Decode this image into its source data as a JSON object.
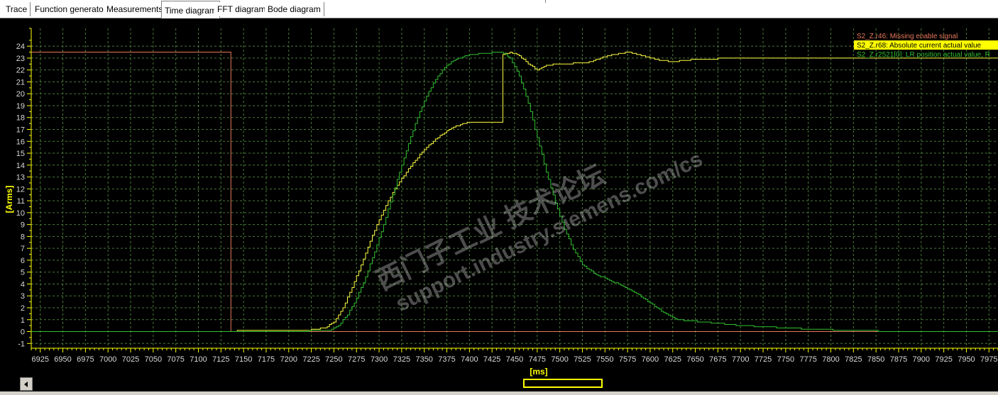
{
  "tabs": [
    {
      "label": "Trace"
    },
    {
      "label": "Function generator"
    },
    {
      "label": "Measurements"
    },
    {
      "label": "Time diagram",
      "active": true
    },
    {
      "label": "FFT diagram"
    },
    {
      "label": "Bode diagram"
    }
  ],
  "watermark": {
    "line1": "西门子工业  技术论坛",
    "line2": "support.industry.siemens.com/cs"
  },
  "colors": {
    "background": "#000000",
    "grid": "#4a7a3a",
    "axis": "#ffff00",
    "tick_label": "#d8d8d8",
    "missing_enable": "#e8785a",
    "current": "#ffff40",
    "position": "#30c030"
  },
  "chart_data": {
    "type": "line",
    "ylabel": "[Arms]",
    "xlabel": "[ms]",
    "xlim": [
      6915,
      7985
    ],
    "ylim": [
      -1.4,
      25.5
    ],
    "grid": true,
    "legend_position": "top-right",
    "y_ticks": [
      -1,
      0,
      1,
      2,
      3,
      4,
      5,
      6,
      7,
      8,
      9,
      10,
      11,
      12,
      13,
      14,
      15,
      16,
      17,
      18,
      19,
      20,
      21,
      22,
      23,
      24
    ],
    "x_ticks": [
      6925,
      6950,
      6975,
      7000,
      7025,
      7050,
      7075,
      7100,
      7125,
      7150,
      7175,
      7200,
      7225,
      7250,
      7275,
      7300,
      7325,
      7350,
      7375,
      7400,
      7425,
      7450,
      7475,
      7500,
      7525,
      7550,
      7575,
      7600,
      7625,
      7650,
      7675,
      7700,
      7725,
      7750,
      7775,
      7800,
      7825,
      7850,
      7875,
      7900,
      7925,
      7950,
      7975
    ],
    "series": [
      {
        "name": "S2_Z.r46: Missing enable signal",
        "color": "#e8785a",
        "step": true,
        "x": [
          6915,
          7136,
          7136,
          7985
        ],
        "y": [
          23.5,
          23.5,
          0,
          0
        ]
      },
      {
        "name": "S2_Z.r68: Absolute current actual value",
        "color": "#ffff40",
        "step": true,
        "x": [
          6915,
          7136,
          7150,
          7175,
          7200,
          7225,
          7240,
          7250,
          7260,
          7270,
          7280,
          7290,
          7300,
          7310,
          7320,
          7330,
          7340,
          7350,
          7360,
          7370,
          7380,
          7390,
          7400,
          7420,
          7436,
          7437,
          7445,
          7455,
          7465,
          7475,
          7485,
          7500,
          7530,
          7545,
          7560,
          7575,
          7590,
          7610,
          7625,
          7650,
          7700,
          7750,
          7800,
          7850,
          7900,
          7950,
          7985
        ],
        "y": [
          0,
          0,
          0.1,
          0.1,
          0.1,
          0.15,
          0.3,
          0.8,
          2.0,
          3.7,
          5.6,
          7.6,
          9.4,
          11.0,
          12.3,
          13.4,
          14.4,
          15.3,
          16.0,
          16.6,
          17.1,
          17.4,
          17.6,
          17.6,
          17.55,
          23.3,
          23.5,
          23.2,
          22.5,
          22.0,
          22.4,
          22.5,
          22.6,
          23.0,
          23.3,
          23.5,
          23.2,
          22.8,
          22.7,
          22.9,
          23.0,
          23.0,
          23.0,
          23.0,
          23.0,
          23.0,
          23.0
        ]
      },
      {
        "name": "S2_Z.r2521[0]: LR position actual value, R",
        "color": "#30c030",
        "step": true,
        "x": [
          6915,
          7200,
          7245,
          7255,
          7265,
          7275,
          7285,
          7295,
          7305,
          7315,
          7325,
          7335,
          7345,
          7355,
          7365,
          7375,
          7385,
          7395,
          7405,
          7415,
          7425,
          7435,
          7445,
          7455,
          7465,
          7475,
          7485,
          7495,
          7505,
          7515,
          7525,
          7540,
          7555,
          7570,
          7585,
          7600,
          7615,
          7630,
          7650,
          7675,
          7700,
          7750,
          7800,
          7850,
          7900,
          7950,
          7985
        ],
        "y": [
          0,
          0,
          0.1,
          0.5,
          1.4,
          2.8,
          4.6,
          6.7,
          9.0,
          11.5,
          14.0,
          16.4,
          18.5,
          20.2,
          21.5,
          22.4,
          22.9,
          23.2,
          23.3,
          23.4,
          23.45,
          23.5,
          23.0,
          21.5,
          19.2,
          16.3,
          13.4,
          10.8,
          8.6,
          6.9,
          5.6,
          4.8,
          4.3,
          3.8,
          3.2,
          2.4,
          1.6,
          1.0,
          0.85,
          0.7,
          0.5,
          0.3,
          0.15,
          0.05,
          0.02,
          0.0,
          0.0
        ]
      }
    ]
  }
}
